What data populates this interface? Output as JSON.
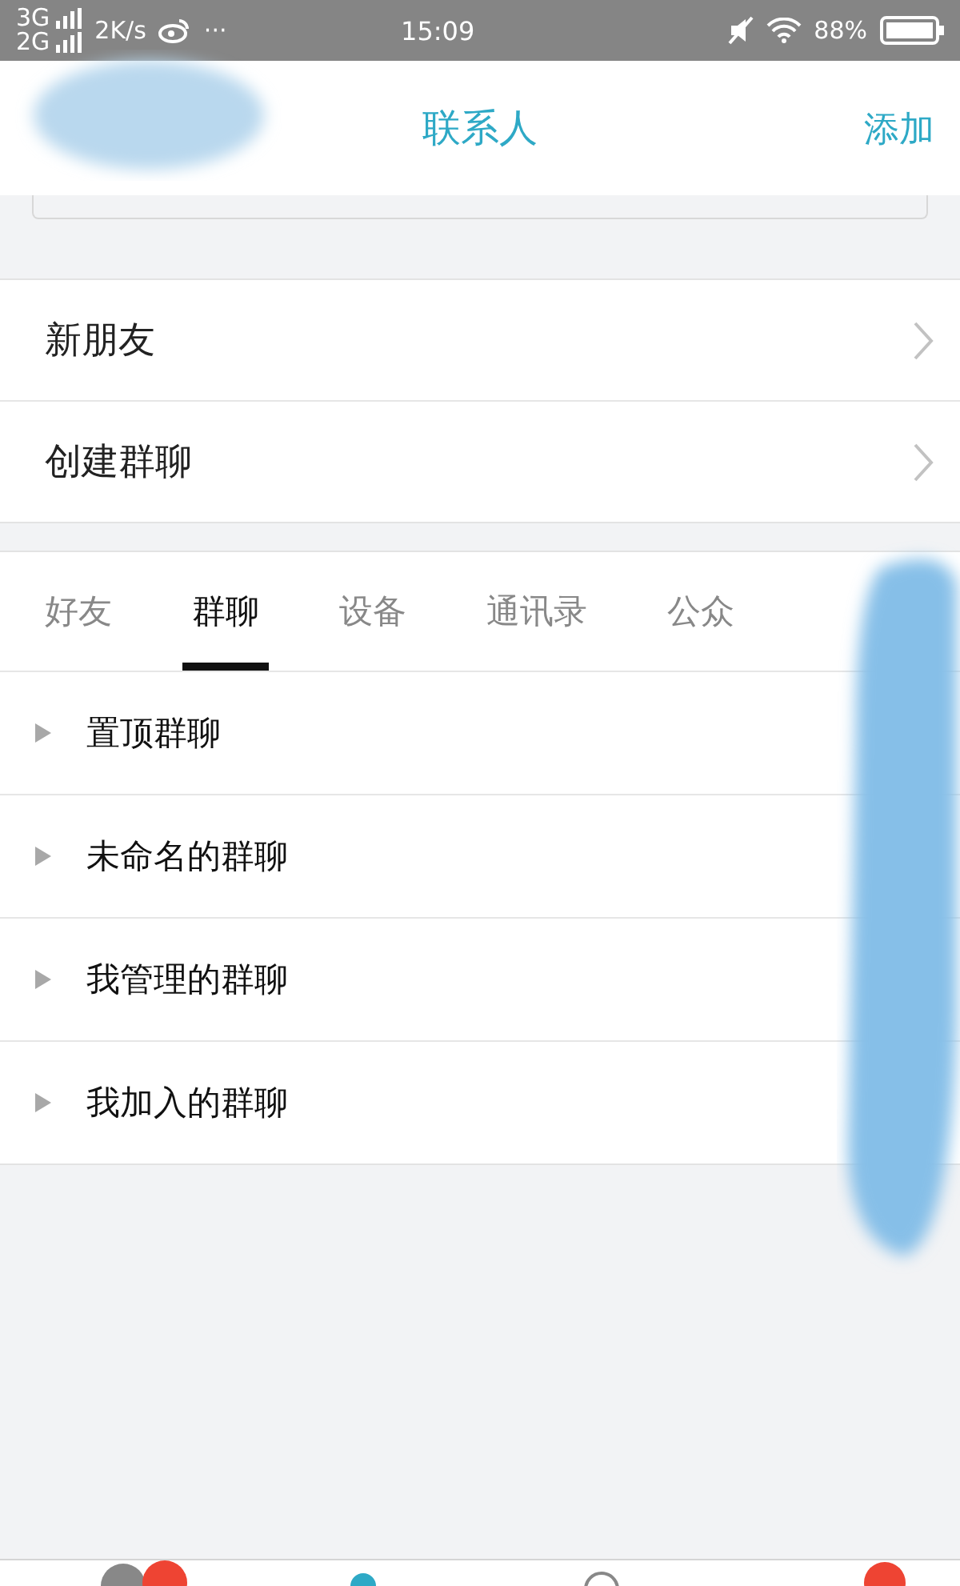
{
  "status_bar": {
    "networks": [
      "3G",
      "2G"
    ],
    "speed": "2K/s",
    "more": "···",
    "time": "15:09",
    "battery": "88%"
  },
  "header": {
    "title": "联系人",
    "action": "添加"
  },
  "entries": [
    {
      "label": "新朋友"
    },
    {
      "label": "创建群聊"
    }
  ],
  "tabs": [
    {
      "label": "好友",
      "selected": false
    },
    {
      "label": "群聊",
      "selected": true
    },
    {
      "label": "设备",
      "selected": false
    },
    {
      "label": "通讯录",
      "selected": false
    },
    {
      "label": "公众",
      "selected": false
    }
  ],
  "groups": [
    {
      "label": "置顶群聊",
      "expanded": false
    },
    {
      "label": "未命名的群聊",
      "expanded": false
    },
    {
      "label": "我管理的群聊",
      "expanded": false
    },
    {
      "label": "我加入的群聊",
      "expanded": false
    }
  ]
}
